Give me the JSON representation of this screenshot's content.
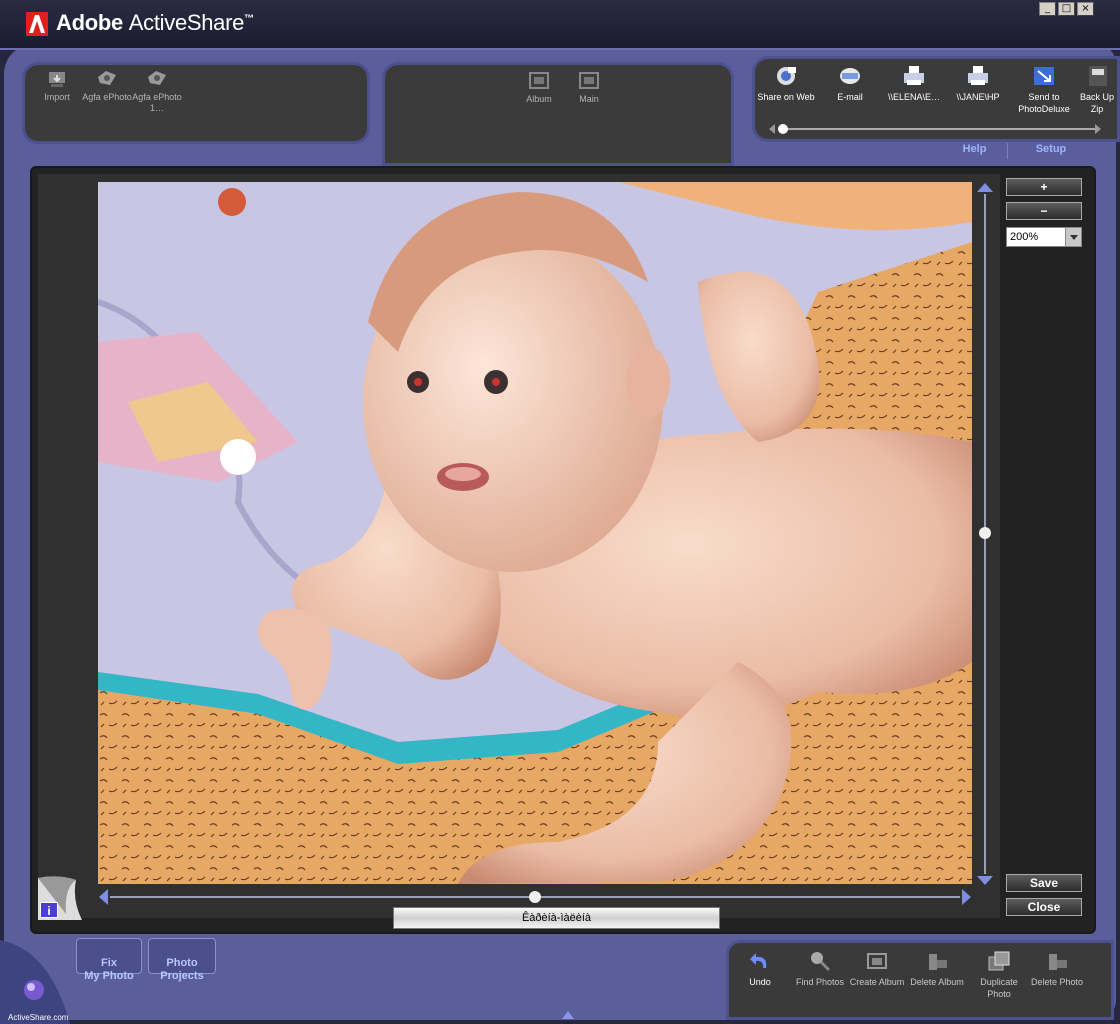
{
  "app": {
    "brand": "Adobe",
    "product": "ActiveShare",
    "trademark": "™",
    "window_buttons": [
      "_",
      "□",
      "×"
    ]
  },
  "import_pod": {
    "items": [
      {
        "label": "Import",
        "icon": "import-icon"
      },
      {
        "label": "Agfa ePhoto",
        "icon": "camera-icon"
      },
      {
        "label": "Agfa ePhoto 1…",
        "icon": "camera-icon"
      }
    ]
  },
  "view_pod": {
    "items": [
      {
        "label": "Album",
        "icon": "album-icon"
      },
      {
        "label": "Main",
        "icon": "main-icon"
      }
    ]
  },
  "share_pod": {
    "items": [
      {
        "label": "Share on Web",
        "icon": "web-icon"
      },
      {
        "label": "E-mail",
        "icon": "email-icon"
      },
      {
        "label": "\\\\ELENA\\E…",
        "icon": "printer-icon"
      },
      {
        "label": "\\\\JANE\\HP",
        "icon": "printer-icon"
      },
      {
        "label": "Send to PhotoDeluxe",
        "icon": "send-icon"
      },
      {
        "label": "Back Up Zip",
        "icon": "zip-icon"
      }
    ]
  },
  "nav": {
    "help": "Help",
    "setup": "Setup"
  },
  "viewer": {
    "zoom_in": "+",
    "zoom_out": "−",
    "zoom_value": "200%",
    "save": "Save",
    "close": "Close",
    "caption": "Êàðèíà-ìàëèíà",
    "info": "i"
  },
  "tabs": {
    "fix_photo": "Fix\nMy Photo",
    "photo_projects": "Photo\nProjects"
  },
  "toolbar": {
    "items": [
      {
        "label": "Undo",
        "icon": "undo-icon",
        "enabled": true
      },
      {
        "label": "Find Photos",
        "icon": "find-icon",
        "enabled": false
      },
      {
        "label": "Create Album",
        "icon": "create-album-icon",
        "enabled": false
      },
      {
        "label": "Delete Album",
        "icon": "delete-album-icon",
        "enabled": false
      },
      {
        "label": "Duplicate Photo",
        "icon": "duplicate-icon",
        "enabled": false
      },
      {
        "label": "Delete Photo",
        "icon": "delete-photo-icon",
        "enabled": false
      }
    ]
  },
  "badge": {
    "text": "ActiveShare.com"
  },
  "colors": {
    "frame": "#5a5f9c",
    "pod": "#3b3b3b",
    "accent": "#9fb3ff"
  }
}
